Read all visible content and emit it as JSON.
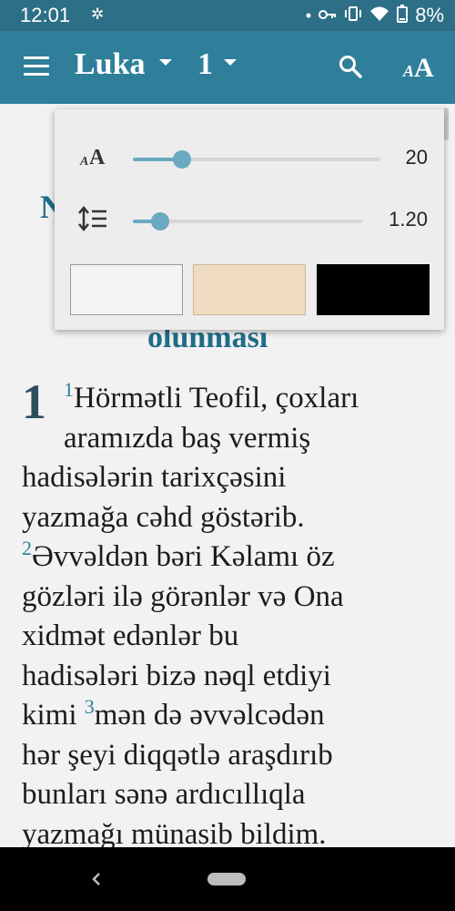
{
  "status_bar": {
    "time": "12:01",
    "battery": "8%",
    "icons": [
      "settings-icon",
      "dot-icon",
      "key-icon",
      "vibrate-icon",
      "wifi-icon",
      "battery-icon"
    ]
  },
  "app_bar": {
    "book": "Luka",
    "chapter": "1",
    "icons": [
      "menu-icon",
      "search-icon",
      "font-settings-icon"
    ]
  },
  "text_settings": {
    "font_size": {
      "value": "20",
      "level": 0.2
    },
    "line_spacing": {
      "value": "1.20",
      "level": 0.12
    },
    "themes": [
      {
        "name": "white",
        "color": "#f4f4f4"
      },
      {
        "name": "sepia",
        "color": "#efdcc0"
      },
      {
        "name": "black",
        "color": "#000000"
      }
    ]
  },
  "content": {
    "heading_left_fragment": "N",
    "heading_fragment": "olunması",
    "chapter_number": "1",
    "lines": [
      {
        "vnum": "1",
        "text": "Hörmətli Teofil, çoxları"
      },
      {
        "text": "aramızda baş vermiş"
      },
      {
        "text": "hadisələrin tarixçəsini"
      },
      {
        "text": "yazmağa cəhd göstərib."
      },
      {
        "vnum": "2",
        "text": "Əvvəldən bəri Kəlamı öz"
      },
      {
        "text": "gözləri ilə görənlər və Ona"
      },
      {
        "text": "xidmət edənlər bu"
      },
      {
        "text": "hadisələri bizə nəql etdiyi"
      },
      {
        "text": "kimi",
        "vnum2": "3",
        "text2": "mən də əvvəlcədən"
      },
      {
        "text": "hər şeyi diqqətlə araşdırıb"
      },
      {
        "text": "bunları sənə ardıcıllıqla"
      },
      {
        "text": "yazmağı münasib bildim."
      }
    ]
  },
  "colors": {
    "status_bar": "#2c6f86",
    "app_bar": "#2f7f9b",
    "accent": "#6aa9c0",
    "heading": "#1f6d87"
  }
}
